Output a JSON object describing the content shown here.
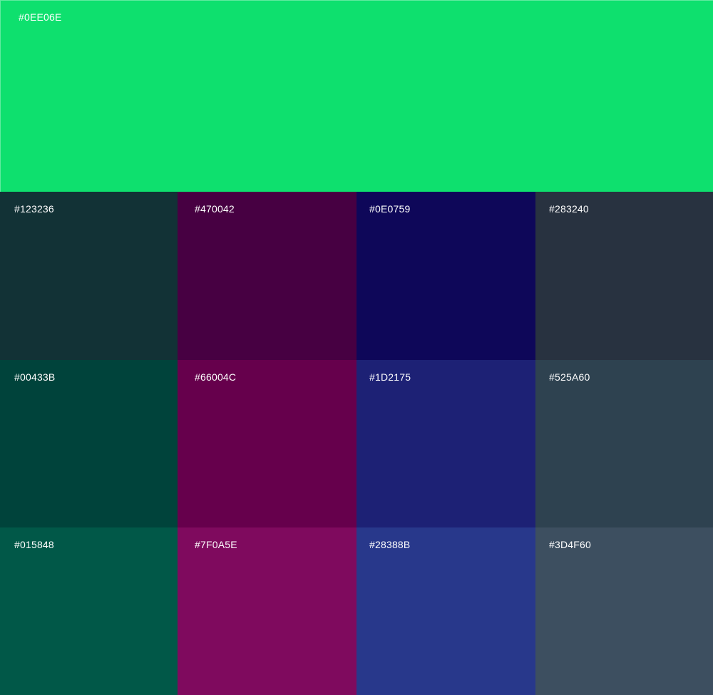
{
  "hero": {
    "hex": "#0EE06E",
    "color": "#0EE06E"
  },
  "swatches": [
    {
      "hex": "#123236",
      "color": "#123236"
    },
    {
      "hex": "#470042",
      "color": "#470042"
    },
    {
      "hex": "#0E0759",
      "color": "#0E0759"
    },
    {
      "hex": "#283240",
      "color": "#283240"
    },
    {
      "hex": "#00433B",
      "color": "#00433B"
    },
    {
      "hex": "#66004C",
      "color": "#66004C"
    },
    {
      "hex": "#1D2175",
      "color": "#1D2175"
    },
    {
      "hex": "#525A60",
      "color": "#2E4250"
    },
    {
      "hex": "#015848",
      "color": "#015848"
    },
    {
      "hex": "#7F0A5E",
      "color": "#7F0A5E"
    },
    {
      "hex": "#28388B",
      "color": "#28388B"
    },
    {
      "hex": "#3D4F60",
      "color": "#3D4F60"
    }
  ]
}
